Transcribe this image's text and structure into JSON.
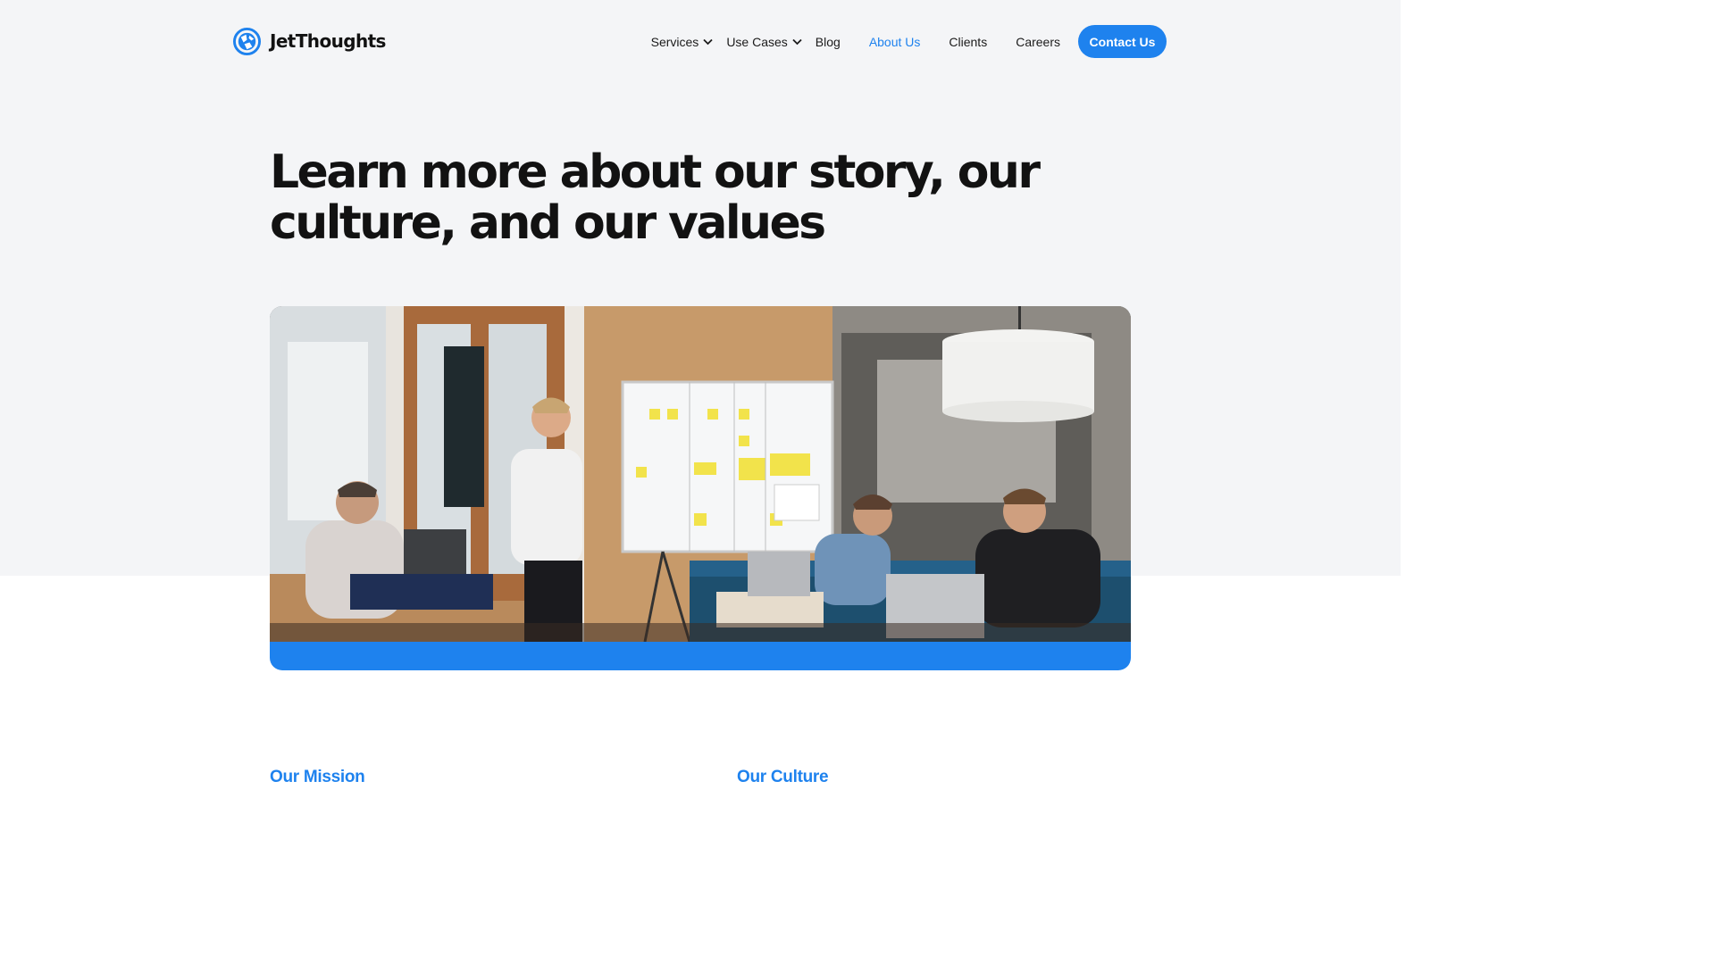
{
  "header": {
    "logo_text": "JetThoughts",
    "logo_icon": "globe-logo-icon",
    "nav": {
      "services": "Services",
      "use_cases": "Use Cases",
      "blog": "Blog",
      "about": "About Us",
      "clients": "Clients",
      "careers": "Careers"
    },
    "contact_label": "Contact Us"
  },
  "hero": {
    "title": "Learn more about our story, our culture, and our values"
  },
  "sections": {
    "mission_title": "Our Mission",
    "culture_title": "Our Culture"
  },
  "colors": {
    "accent": "#1e82ee",
    "hero_background": "#f4f5f7",
    "text": "#121212"
  }
}
